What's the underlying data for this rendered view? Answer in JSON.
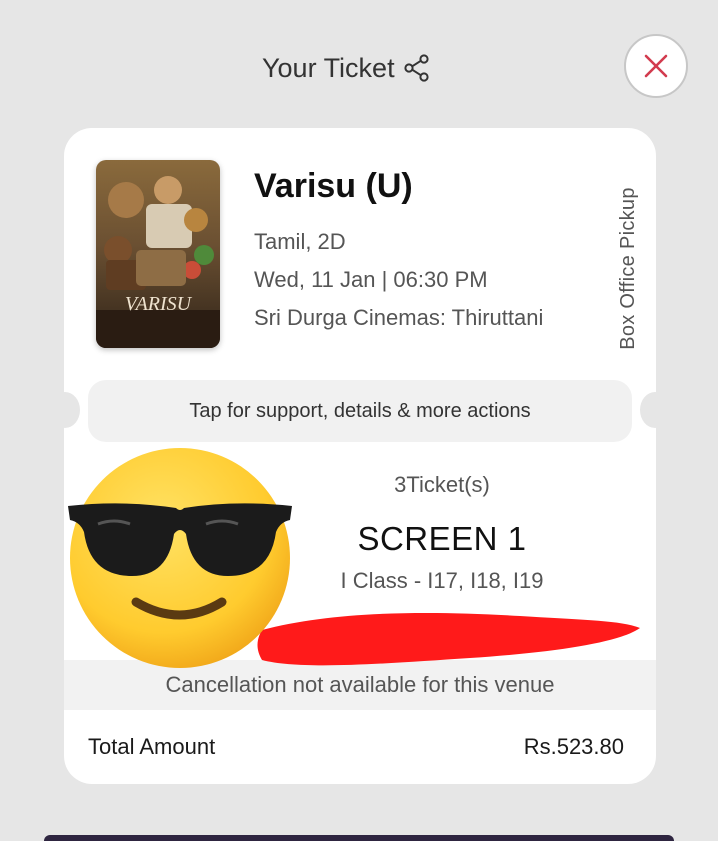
{
  "header": {
    "title": "Your Ticket",
    "share_icon": "share-icon",
    "close_icon": "close-icon",
    "close_color": "#d23b4e"
  },
  "movie": {
    "title": "Varisu (U)",
    "language_format": "Tamil, 2D",
    "datetime": "Wed, 11 Jan | 06:30 PM",
    "cinema": "Sri Durga Cinemas: Thiruttani",
    "poster_text": "VARISU",
    "pickup_label": "Box Office Pickup"
  },
  "support": {
    "label": "Tap for support, details & more actions"
  },
  "booking": {
    "ticket_count": "3Ticket(s)",
    "screen": "SCREEN 1",
    "seats": "I Class - I17, I18, I19"
  },
  "cancellation": {
    "notice": "Cancellation not available for this venue"
  },
  "total": {
    "label": "Total Amount",
    "amount": "Rs.523.80"
  },
  "overlays": {
    "emoji": "sunglasses-emoji",
    "redaction_color": "#ff1a1a"
  }
}
